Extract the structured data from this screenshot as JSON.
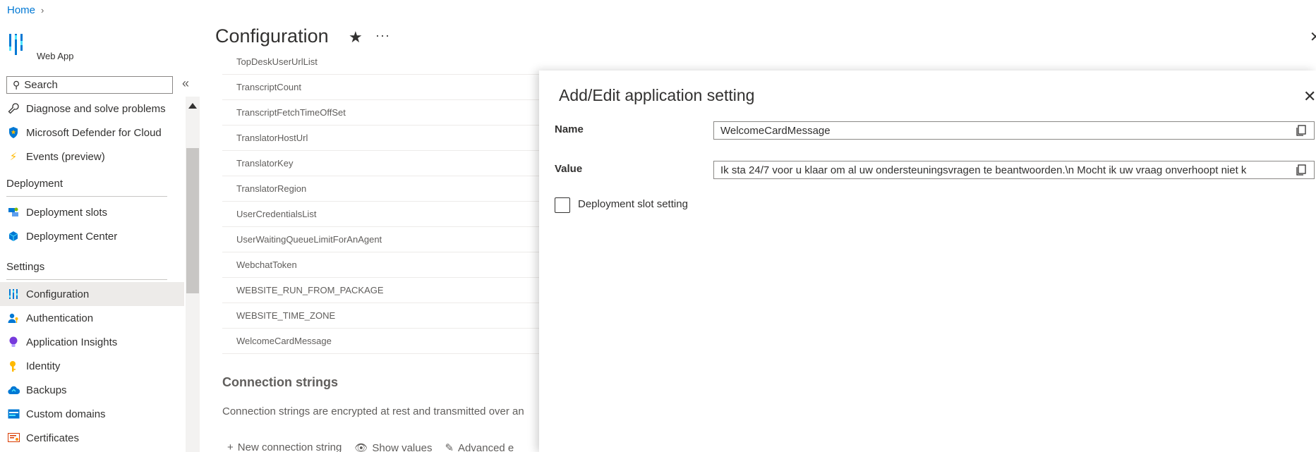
{
  "breadcrumb": {
    "home": "Home"
  },
  "app": {
    "subtitle": "Web App"
  },
  "header": {
    "title": "Configuration"
  },
  "search": {
    "placeholder": "Search"
  },
  "sidebar": {
    "items": [
      {
        "label": "Diagnose and solve problems",
        "icon": "wrench-icon"
      },
      {
        "label": "Microsoft Defender for Cloud",
        "icon": "shield-icon"
      },
      {
        "label": "Events (preview)",
        "icon": "lightning-icon"
      }
    ],
    "deployment_section": "Deployment",
    "deployment_items": [
      {
        "label": "Deployment slots",
        "icon": "slots-icon"
      },
      {
        "label": "Deployment Center",
        "icon": "cube-icon"
      }
    ],
    "settings_section": "Settings",
    "settings_items": [
      {
        "label": "Configuration",
        "icon": "config-icon"
      },
      {
        "label": "Authentication",
        "icon": "user-key-icon"
      },
      {
        "label": "Application Insights",
        "icon": "bulb-icon"
      },
      {
        "label": "Identity",
        "icon": "key-icon"
      },
      {
        "label": "Backups",
        "icon": "cloud-icon"
      },
      {
        "label": "Custom domains",
        "icon": "domain-icon"
      },
      {
        "label": "Certificates",
        "icon": "certificate-icon"
      }
    ]
  },
  "app_settings": {
    "rows": [
      "TopDeskUserUrlList",
      "TranscriptCount",
      "TranscriptFetchTimeOffSet",
      "TranslatorHostUrl",
      "TranslatorKey",
      "TranslatorRegion",
      "UserCredentialsList",
      "UserWaitingQueueLimitForAnAgent",
      "WebchatToken",
      "WEBSITE_RUN_FROM_PACKAGE",
      "WEBSITE_TIME_ZONE",
      "WelcomeCardMessage"
    ]
  },
  "connection_strings": {
    "title": "Connection strings",
    "description": "Connection strings are encrypted at rest and transmitted over an",
    "new_label": "New connection string",
    "show_label": "Show values",
    "advanced_label": "Advanced e"
  },
  "panel": {
    "title": "Add/Edit application setting",
    "name_label": "Name",
    "name_value": "WelcomeCardMessage",
    "value_label": "Value",
    "value_value": "Ik sta 24/7 voor u klaar om al uw ondersteuningsvragen te beantwoorden.\\n Mocht ik uw vraag onverhoopt niet k",
    "slot_label": "Deployment slot setting",
    "slot_checked": false
  }
}
